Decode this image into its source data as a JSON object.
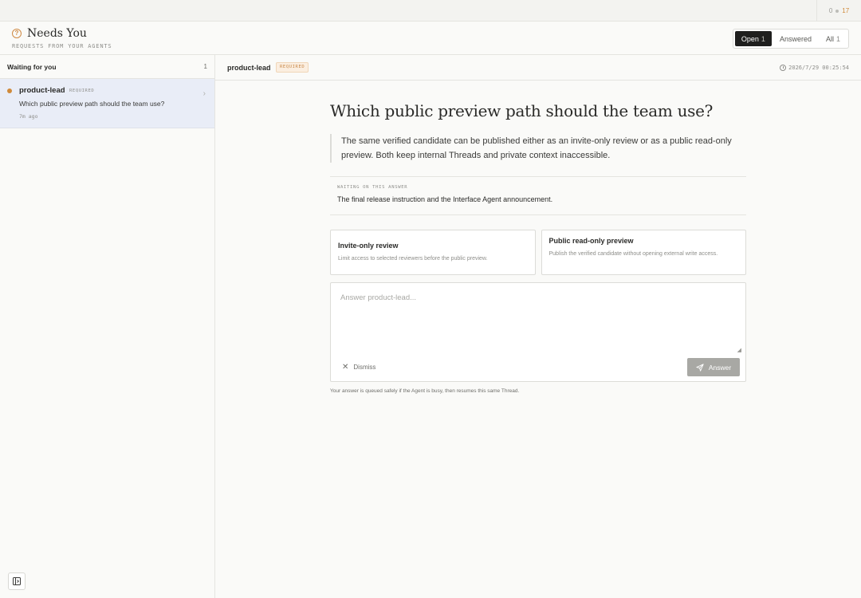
{
  "topstrip": {
    "status_left": "0",
    "status_right": "17"
  },
  "header": {
    "title": "Needs You",
    "subtitle": "REQUESTS FROM YOUR AGENTS",
    "tabs": [
      {
        "label": "Open",
        "count": "1",
        "active": true
      },
      {
        "label": "Answered",
        "count": "",
        "active": false
      },
      {
        "label": "All",
        "count": "1",
        "active": false
      }
    ]
  },
  "sidebar": {
    "heading": "Waiting for you",
    "count": "1",
    "items": [
      {
        "agent": "product-lead",
        "badge": "REQUIRED",
        "question": "Which public preview path should the team use?",
        "age": "7m ago"
      }
    ]
  },
  "main": {
    "agent": "product-lead",
    "badge": "REQUIRED",
    "timestamp": "2026/7/29 00:25:54",
    "question": "Which public preview path should the team use?",
    "context": "The same verified candidate can be published either as an invite-only review or as a public read-only preview. Both keep internal Threads and private context inaccessible.",
    "waiting_label": "WAITING ON THIS ANSWER",
    "waiting_text": "The final release instruction and the Interface Agent announcement.",
    "options": [
      {
        "title": "Invite-only review",
        "description": "Limit access to selected reviewers before the public preview."
      },
      {
        "title": "Public read-only preview",
        "description": "Publish the verified candidate without opening external write access."
      }
    ],
    "answer_placeholder": "Answer product-lead...",
    "dismiss_label": "Dismiss",
    "answer_label": "Answer",
    "hint": "Your answer is queued safely if the Agent is busy, then resumes this same Thread."
  }
}
